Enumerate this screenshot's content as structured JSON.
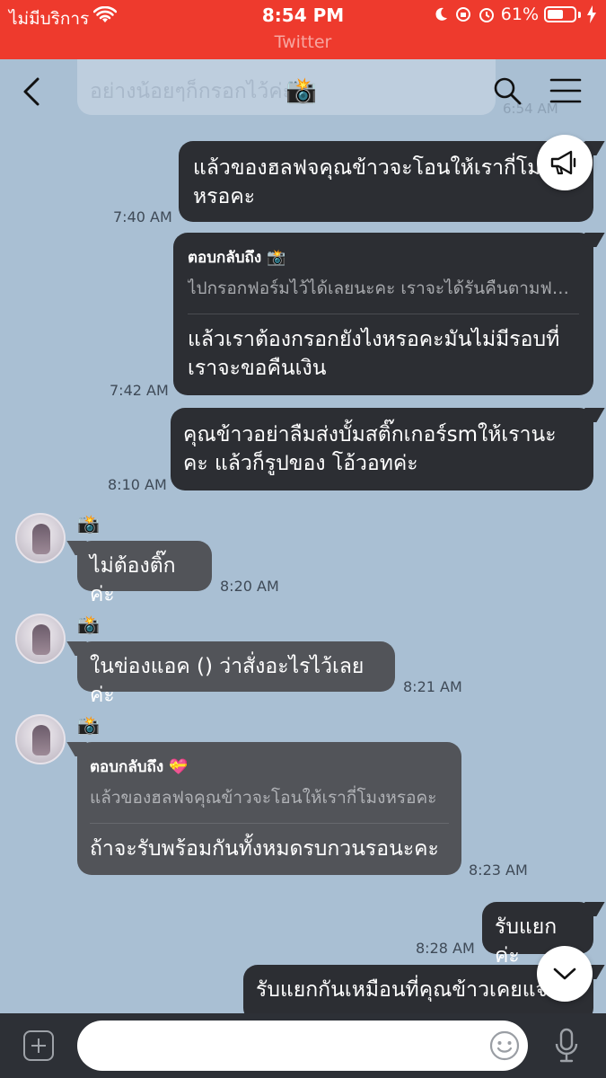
{
  "status_bar": {
    "carrier": "ไม่มีบริการ",
    "time": "8:54 PM",
    "battery": "61%",
    "battery_level": 0.61,
    "source_app": "Twitter"
  },
  "header": {
    "back_icon": "chevron-left-icon",
    "search_icon": "search-icon",
    "menu_icon": "hamburger-menu-icon",
    "previous_message_text": "อย่างน้อยๆก็กรอกไว้ค่ะ",
    "previous_message_time": "6:54 AM"
  },
  "messages": [
    {
      "side": "out",
      "text": "แล้วของฮลฟจคุณข้าวจะโอนให้เรากี่โมงหรอคะ",
      "time": "7:40 AM"
    },
    {
      "side": "out",
      "reply_label": "ตอบกลับถึง 📸",
      "reply_quote": "ไปกรอกฟอร์มไว้ได้เลยนะคะ เราจะได้รันคืนตามฟอร์มค่ะ",
      "text": "แล้วเราต้องกรอกยังไงหรอคะมันไม่มีรอบที่เราจะขอคืนเงิน",
      "time": "7:42 AM"
    },
    {
      "side": "out",
      "text": "คุณข้าวอย่าลืมส่งบั้มสติ๊กเกอร์smให้เรานะคะ แล้วก็รูปของ โอ้วอทค่ะ",
      "time": "8:10 AM"
    },
    {
      "side": "in",
      "sender": "📸",
      "text": "ไม่ต้องติ๊กค่ะ",
      "time": "8:20 AM"
    },
    {
      "side": "in",
      "sender": "📸",
      "text": "ในข่องแอค () ว่าสั่งอะไรไว้เลยค่ะ",
      "time": "8:21 AM"
    },
    {
      "side": "in",
      "sender": "📸",
      "reply_label": "ตอบกลับถึง 💝",
      "reply_quote": "แล้วของฮลฟจคุณข้าวจะโอนให้เรากี่โมงหรอคะ",
      "text": "ถ้าจะรับพร้อมกันทั้งหมดรบกวนรอนะคะ",
      "time": "8:23 AM"
    },
    {
      "side": "out",
      "text": "รับแยกค่ะ",
      "time": "8:28 AM"
    },
    {
      "side": "out",
      "text": "รับแยกกันเหมือนที่คุณข้าวเคยแจ้งค่ะ",
      "time": ""
    }
  ],
  "floating": {
    "announce_icon": "megaphone-icon",
    "scroll_down_icon": "chevron-down-icon"
  },
  "composer": {
    "plus_icon": "plus-icon",
    "input_value": "",
    "emoji_icon": "emoji-icon",
    "mic_icon": "microphone-icon"
  }
}
